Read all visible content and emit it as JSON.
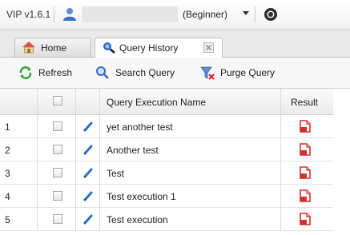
{
  "topbar": {
    "version": "VIP v1.6.1",
    "user_level": "(Beginner)"
  },
  "tabs": [
    {
      "label": "Home",
      "icon": "home-icon"
    },
    {
      "label": "Query History",
      "icon": "query-history-icon",
      "active": true
    }
  ],
  "toolbar": {
    "refresh_label": "Refresh",
    "search_label": "Search Query",
    "purge_label": "Purge Query"
  },
  "table": {
    "columns": [
      "",
      "",
      "",
      "Query Execution Name",
      "Result"
    ],
    "rows": [
      {
        "num": "1",
        "name": "yet another test"
      },
      {
        "num": "2",
        "name": "Another test"
      },
      {
        "num": "3",
        "name": "Test"
      },
      {
        "num": "4",
        "name": "Test execution 1"
      },
      {
        "num": "5",
        "name": "Test execution"
      }
    ]
  },
  "colors": {
    "accent_blue": "#2f6fc4",
    "refresh_green": "#3aa33a",
    "result_red": "#d32f2f"
  }
}
